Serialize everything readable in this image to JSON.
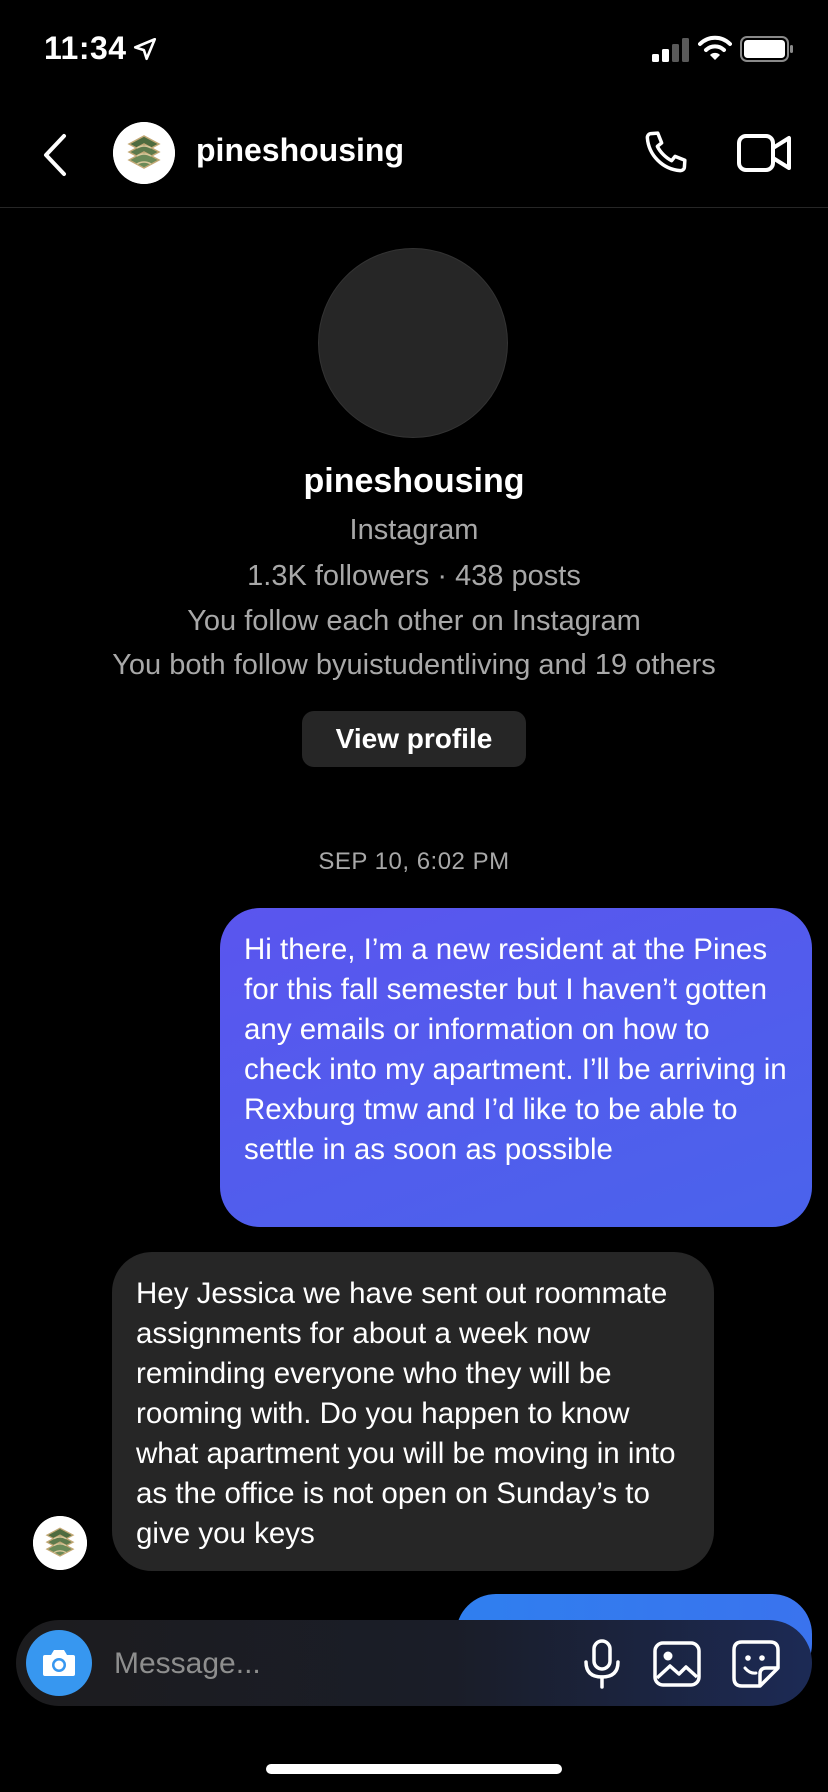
{
  "status_bar": {
    "time": "11:34",
    "icons": [
      "location-arrow-icon",
      "signal-icon",
      "wifi-icon",
      "battery-icon"
    ]
  },
  "header": {
    "title": "pineshousing",
    "icons": [
      "back-chevron-icon",
      "phone-icon",
      "video-camera-icon"
    ]
  },
  "profile": {
    "name": "pineshousing",
    "platform": "Instagram",
    "stats": "1.3K followers · 438 posts",
    "relationship": "You follow each other on Instagram",
    "mutuals": "You both follow byuistudentliving and 19 others",
    "view_profile_label": "View profile"
  },
  "conversation": {
    "timestamp": "SEP 10, 6:02 PM",
    "messages": [
      {
        "direction": "outgoing",
        "text": "Hi there, I’m a new resident at the Pines for this fall semester but I haven’t gotten any emails or information on how to check into my apartment. I’ll be arriving in Rexburg tmw and I’d like to be able to settle in as soon as possible"
      },
      {
        "direction": "incoming",
        "text": "Hey Jessica we have sent out roommate assignments for about a week now reminding everyone who they will be rooming with. Do you happen to know what apartment you will be moving in into as the office is not open on Sunday’s to give you keys"
      }
    ]
  },
  "composer": {
    "placeholder": "Message...",
    "icons": [
      "camera-icon",
      "microphone-icon",
      "gallery-icon",
      "sticker-icon"
    ]
  },
  "colors": {
    "background": "#000000",
    "outgoing_bubble": "#5160ED",
    "incoming_bubble": "#262626",
    "accent_blue": "#3797F0",
    "secondary_text": "#A8A8A8"
  }
}
